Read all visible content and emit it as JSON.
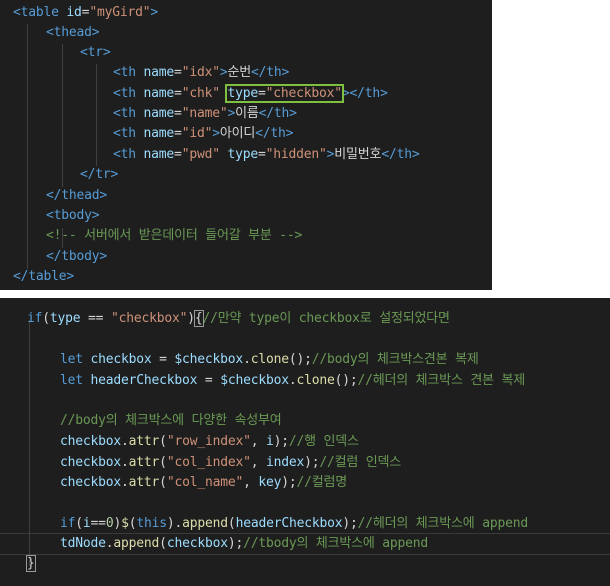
{
  "html_panel": {
    "lines": [
      [
        [
          "<",
          "tag"
        ],
        [
          "table ",
          "tag"
        ],
        [
          "id",
          "attr"
        ],
        [
          "=",
          "punc"
        ],
        [
          "\"myGird\"",
          "str"
        ],
        [
          ">",
          "tag"
        ]
      ],
      [
        [
          "<",
          "tag"
        ],
        [
          "thead",
          "tag"
        ],
        [
          ">",
          "tag"
        ]
      ],
      [
        [
          "<",
          "tag"
        ],
        [
          "tr",
          "tag"
        ],
        [
          ">",
          "tag"
        ]
      ],
      [
        [
          "<",
          "tag"
        ],
        [
          "th ",
          "tag"
        ],
        [
          "name",
          "attr"
        ],
        [
          "=",
          "punc"
        ],
        [
          "\"idx\"",
          "str"
        ],
        [
          ">",
          "tag"
        ],
        [
          "순번",
          "text"
        ],
        [
          "</",
          "tag"
        ],
        [
          "th",
          "tag"
        ],
        [
          ">",
          "tag"
        ]
      ],
      [
        [
          "<",
          "tag"
        ],
        [
          "th ",
          "tag"
        ],
        [
          "name",
          "attr"
        ],
        [
          "=",
          "punc"
        ],
        [
          "\"chk\" ",
          "str"
        ],
        [
          "type",
          "attr hl-start"
        ],
        [
          "=",
          "punc"
        ],
        [
          "\"checkbox\"",
          "str hl-end"
        ],
        [
          ">",
          "tag"
        ],
        [
          "</",
          "tag"
        ],
        [
          "th",
          "tag"
        ],
        [
          ">",
          "tag"
        ]
      ],
      [
        [
          "<",
          "tag"
        ],
        [
          "th ",
          "tag"
        ],
        [
          "name",
          "attr"
        ],
        [
          "=",
          "punc"
        ],
        [
          "\"name\"",
          "str"
        ],
        [
          ">",
          "tag"
        ],
        [
          "이름",
          "text"
        ],
        [
          "</",
          "tag"
        ],
        [
          "th",
          "tag"
        ],
        [
          ">",
          "tag"
        ]
      ],
      [
        [
          "<",
          "tag"
        ],
        [
          "th ",
          "tag"
        ],
        [
          "name",
          "attr"
        ],
        [
          "=",
          "punc"
        ],
        [
          "\"id\"",
          "str"
        ],
        [
          ">",
          "tag"
        ],
        [
          "아이디",
          "text"
        ],
        [
          "</",
          "tag"
        ],
        [
          "th",
          "tag"
        ],
        [
          ">",
          "tag"
        ]
      ],
      [
        [
          "<",
          "tag"
        ],
        [
          "th ",
          "tag"
        ],
        [
          "name",
          "attr"
        ],
        [
          "=",
          "punc"
        ],
        [
          "\"pwd\" ",
          "str"
        ],
        [
          "type",
          "attr"
        ],
        [
          "=",
          "punc"
        ],
        [
          "\"hidden\"",
          "str"
        ],
        [
          ">",
          "tag"
        ],
        [
          "비밀번호",
          "text"
        ],
        [
          "</",
          "tag"
        ],
        [
          "th",
          "tag"
        ],
        [
          ">",
          "tag"
        ]
      ],
      [
        [
          "</",
          "tag"
        ],
        [
          "tr",
          "tag"
        ],
        [
          ">",
          "tag"
        ]
      ],
      [
        [
          "</",
          "tag"
        ],
        [
          "thead",
          "tag"
        ],
        [
          ">",
          "tag"
        ]
      ],
      [
        [
          "<",
          "tag"
        ],
        [
          "tbody",
          "tag"
        ],
        [
          ">",
          "tag"
        ]
      ],
      [
        [
          "<!-- 서버에서 받은데이터 들어갈 부분 -->",
          "comment"
        ]
      ],
      [
        [
          "</",
          "tag"
        ],
        [
          "tbody",
          "tag"
        ],
        [
          ">",
          "tag"
        ]
      ],
      [
        [
          "</",
          "tag"
        ],
        [
          "table",
          "tag"
        ],
        [
          ">",
          "tag"
        ]
      ]
    ]
  },
  "js_panel": {
    "lines": [
      [
        [
          "if",
          "kw"
        ],
        [
          "(",
          "punc"
        ],
        [
          "type",
          "var"
        ],
        [
          " == ",
          "punc"
        ],
        [
          "\"checkbox\"",
          "str"
        ],
        [
          ")",
          "punc"
        ],
        [
          "{",
          "brace"
        ],
        [
          "//만약 type이 checkbox로 설정되었다면",
          "comment"
        ]
      ],
      [],
      [
        [
          "let ",
          "kw"
        ],
        [
          "checkbox",
          "var"
        ],
        [
          " = ",
          "punc"
        ],
        [
          "$checkbox",
          "var"
        ],
        [
          ".",
          "punc"
        ],
        [
          "clone",
          "fn"
        ],
        [
          "();",
          "punc"
        ],
        [
          "//body의 체크박스견본 복제",
          "comment"
        ]
      ],
      [
        [
          "let ",
          "kw"
        ],
        [
          "headerCheckbox",
          "var"
        ],
        [
          " = ",
          "punc"
        ],
        [
          "$checkbox",
          "var"
        ],
        [
          ".",
          "punc"
        ],
        [
          "clone",
          "fn"
        ],
        [
          "();",
          "punc"
        ],
        [
          "//헤더의 체크박스 견본 복제",
          "comment"
        ]
      ],
      [],
      [
        [
          "//body의 체크박스에 다양한 속성부여",
          "comment"
        ]
      ],
      [
        [
          "checkbox",
          "var"
        ],
        [
          ".",
          "punc"
        ],
        [
          "attr",
          "fn"
        ],
        [
          "(",
          "punc"
        ],
        [
          "\"row_index\"",
          "str"
        ],
        [
          ", ",
          "punc"
        ],
        [
          "i",
          "var"
        ],
        [
          ");",
          "punc"
        ],
        [
          "//행 인덱스",
          "comment"
        ]
      ],
      [
        [
          "checkbox",
          "var"
        ],
        [
          ".",
          "punc"
        ],
        [
          "attr",
          "fn"
        ],
        [
          "(",
          "punc"
        ],
        [
          "\"col_index\"",
          "str"
        ],
        [
          ", ",
          "punc"
        ],
        [
          "index",
          "var"
        ],
        [
          ");",
          "punc"
        ],
        [
          "//컬럼 인덱스",
          "comment"
        ]
      ],
      [
        [
          "checkbox",
          "var"
        ],
        [
          ".",
          "punc"
        ],
        [
          "attr",
          "fn"
        ],
        [
          "(",
          "punc"
        ],
        [
          "\"col_name\"",
          "str"
        ],
        [
          ", ",
          "punc"
        ],
        [
          "key",
          "var"
        ],
        [
          ");",
          "punc"
        ],
        [
          "//컬럼명",
          "comment"
        ]
      ],
      [],
      [
        [
          "if",
          "kw"
        ],
        [
          "(",
          "punc"
        ],
        [
          "i",
          "var"
        ],
        [
          "==",
          "punc"
        ],
        [
          "0",
          "num"
        ],
        [
          ")",
          "punc"
        ],
        [
          "$",
          "fn"
        ],
        [
          "(",
          "punc"
        ],
        [
          "this",
          "kw"
        ],
        [
          ").",
          "punc"
        ],
        [
          "append",
          "fn"
        ],
        [
          "(",
          "punc"
        ],
        [
          "headerCheckbox",
          "var"
        ],
        [
          ");",
          "punc"
        ],
        [
          "//헤더의 체크박스에 append",
          "comment"
        ]
      ],
      [
        [
          "tdNode",
          "var"
        ],
        [
          ".",
          "punc"
        ],
        [
          "append",
          "fn"
        ],
        [
          "(",
          "punc"
        ],
        [
          "checkbox",
          "var"
        ],
        [
          ");",
          "punc"
        ],
        [
          "//tbody의 체크박스에 append",
          "comment"
        ]
      ],
      [
        [
          "}",
          "brace"
        ]
      ]
    ]
  },
  "colors": {
    "tag": "#569cd6",
    "attr": "#9cdcfe",
    "str": "#ce9178",
    "text": "#d4d4d4",
    "punc": "#d4d4d4",
    "comment": "#6a9955",
    "kw": "#569cd6",
    "var": "#9cdcfe",
    "fn": "#dcdcaa",
    "num": "#b5cea8",
    "brace": "#d4d4d4",
    "highlight_box": "#80c040",
    "background": "#1e1e1e"
  }
}
